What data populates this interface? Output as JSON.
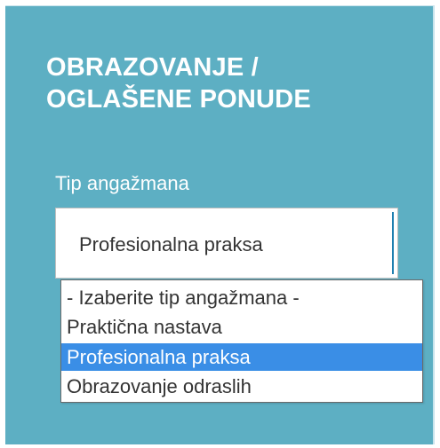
{
  "section": {
    "title_line1": "OBRAZOVANJE /",
    "title_line2": "OGLAŠENE PONUDE"
  },
  "engagement_type": {
    "label": "Tip angažmana",
    "selected_value": "Profesionalna praksa",
    "options": [
      "- Izaberite tip angažmana -",
      "Praktična nastava",
      "Profesionalna praksa",
      "Obrazovanje odraslih"
    ],
    "highlighted_index": 2
  },
  "colors": {
    "panel_background": "#5dafc3",
    "highlight": "#3a8ee6",
    "text": "#333333"
  }
}
